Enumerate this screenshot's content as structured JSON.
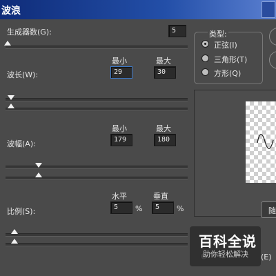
{
  "window": {
    "title": "波浪"
  },
  "generators": {
    "label": "生成器数(G):",
    "value": "5",
    "slider_fraction": 0.0
  },
  "wavelength": {
    "label": "波长(W):",
    "min_header": "最小",
    "max_header": "最大",
    "min": "29",
    "max": "30"
  },
  "amplitude": {
    "label": "波幅(A):",
    "min_header": "最小",
    "max_header": "最大",
    "min": "179",
    "max": "180"
  },
  "scale": {
    "label": "比例(S):",
    "h_header": "水平",
    "v_header": "垂直",
    "h": "5",
    "v": "5",
    "unit": "%"
  },
  "type": {
    "label": "类型:",
    "options": [
      {
        "label": "正弦(I)",
        "selected": true
      },
      {
        "label": "三角形(T)",
        "selected": false
      },
      {
        "label": "方形(Q)",
        "selected": false
      }
    ]
  },
  "randomize_button": {
    "label": "随"
  },
  "watermark": {
    "title": "百科全说",
    "subtitle": "助你轻松解决"
  },
  "bottom_option": {
    "label": "(E)"
  }
}
